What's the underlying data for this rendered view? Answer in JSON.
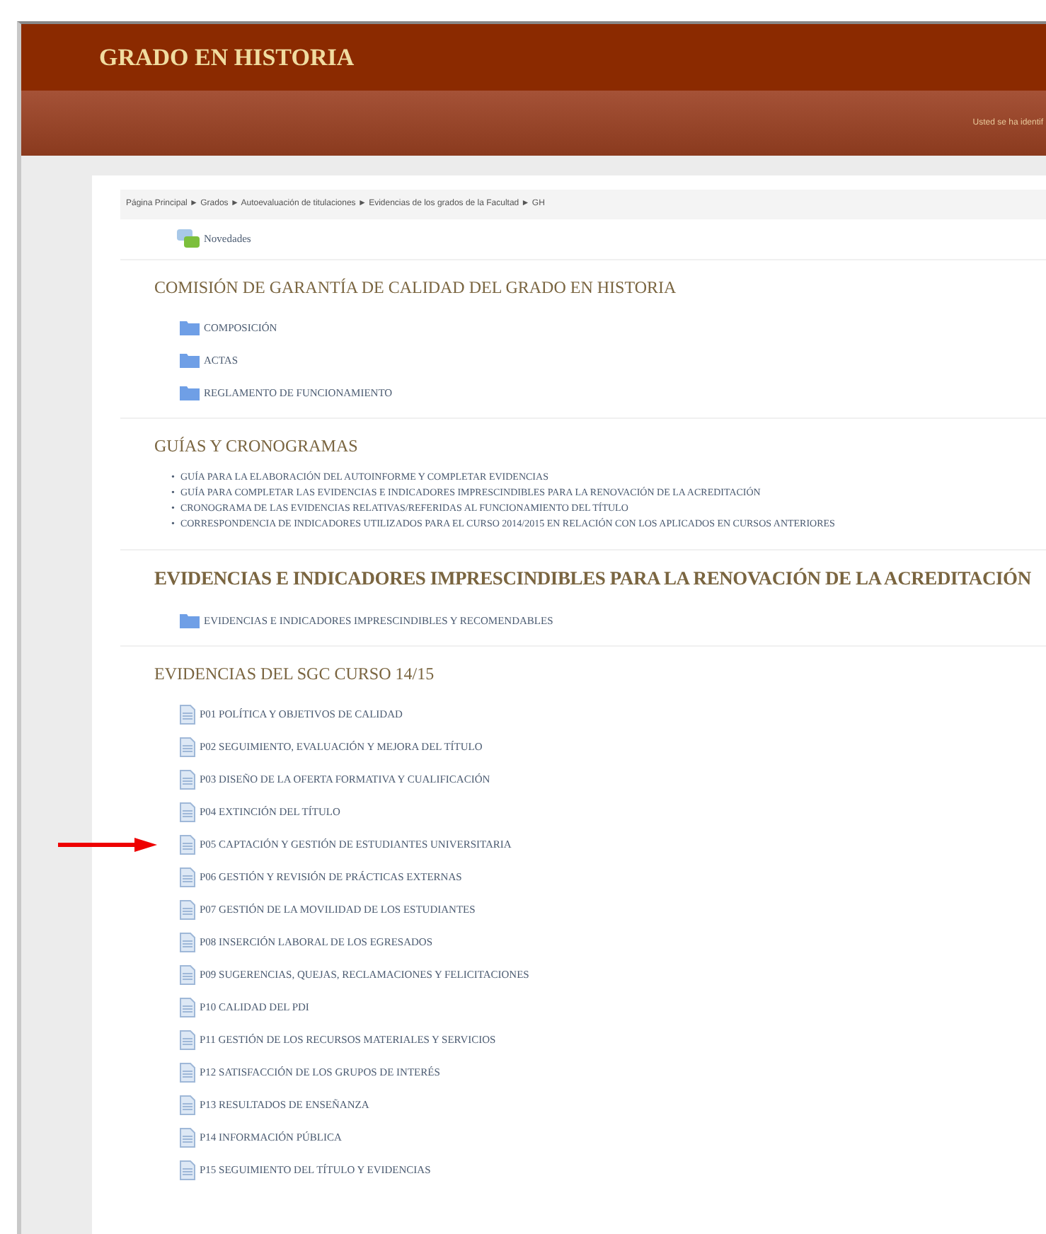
{
  "header": {
    "title": "GRADO EN HISTORIA",
    "user_text": "Usted se ha identif"
  },
  "breadcrumb": "Página Principal ► Grados ► Autoevaluación de titulaciones ► Evidencias de los grados de la Facultad ► GH",
  "top_items": [
    {
      "kind": "forum",
      "label": "Novedades"
    }
  ],
  "sections": [
    {
      "title": "COMISIÓN DE GARANTÍA DE CALIDAD DEL GRADO EN HISTORIA",
      "bold": false,
      "items": [
        {
          "kind": "folder",
          "label": "COMPOSICIÓN",
          "marked": false
        },
        {
          "kind": "folder",
          "label": "ACTAS",
          "marked": false
        },
        {
          "kind": "folder",
          "label": "REGLAMENTO DE FUNCIONAMIENTO",
          "marked": false
        }
      ]
    },
    {
      "title": "GUÍAS Y CRONOGRAMAS",
      "bold": false,
      "items": [
        {
          "kind": "bullet",
          "marker": "•",
          "label": "GUÍA PARA LA ELABORACIÓN DEL AUTOINFORME Y COMPLETAR EVIDENCIAS",
          "marked": false
        },
        {
          "kind": "bullet",
          "marker": "•",
          "label": "GUÍA PARA COMPLETAR LAS EVIDENCIAS E INDICADORES IMPRESCINDIBLES PARA LA RENOVACIÓN DE LA ACREDITACIÓN",
          "marked": false
        },
        {
          "kind": "bullet",
          "marker": "•",
          "label": "CRONOGRAMA DE LAS EVIDENCIAS RELATIVAS/REFERIDAS AL FUNCIONAMIENTO DEL TÍTULO",
          "marked": false
        },
        {
          "kind": "bullet",
          "marker": "•",
          "label": "CORRESPONDENCIA DE INDICADORES UTILIZADOS PARA EL CURSO 2014/2015 EN RELACIÓN CON LOS APLICADOS EN CURSOS ANTERIORES",
          "marked": false
        }
      ]
    },
    {
      "title": "EVIDENCIAS E INDICADORES IMPRESCINDIBLES PARA LA RENOVACIÓN DE LA ACREDITACIÓN",
      "bold": true,
      "items": [
        {
          "kind": "folder",
          "label": "EVIDENCIAS E INDICADORES IMPRESCINDIBLES Y RECOMENDABLES",
          "marked": false
        }
      ]
    },
    {
      "title": "EVIDENCIAS DEL SGC CURSO 14/15",
      "bold": false,
      "items": [
        {
          "kind": "file",
          "label": "P01 POLÍTICA Y OBJETIVOS DE CALIDAD",
          "marked": false
        },
        {
          "kind": "file",
          "label": "P02 SEGUIMIENTO, EVALUACIÓN Y MEJORA DEL TÍTULO",
          "marked": false
        },
        {
          "kind": "file",
          "label": "P03 DISEÑO DE LA OFERTA FORMATIVA Y CUALIFICACIÓN",
          "marked": false
        },
        {
          "kind": "file",
          "label": "P04 EXTINCIÓN DEL TÍTULO",
          "marked": false
        },
        {
          "kind": "file",
          "label": "P05 CAPTACIÓN Y GESTIÓN DE ESTUDIANTES UNIVERSITARIA",
          "marked": true
        },
        {
          "kind": "file",
          "label": "P06 GESTIÓN Y REVISIÓN DE PRÁCTICAS EXTERNAS",
          "marked": false
        },
        {
          "kind": "file",
          "label": "P07 GESTIÓN DE LA MOVILIDAD DE LOS ESTUDIANTES",
          "marked": false
        },
        {
          "kind": "file",
          "label": "P08 INSERCIÓN LABORAL DE LOS EGRESADOS",
          "marked": false
        },
        {
          "kind": "file",
          "label": "P09 SUGERENCIAS, QUEJAS, RECLAMACIONES Y FELICITACIONES",
          "marked": false
        },
        {
          "kind": "file",
          "label": "P10 CALIDAD DEL PDI",
          "marked": false
        },
        {
          "kind": "file",
          "label": "P11 GESTIÓN DE LOS RECURSOS MATERIALES Y SERVICIOS",
          "marked": false
        },
        {
          "kind": "file",
          "label": "P12 SATISFACCIÓN DE LOS GRUPOS DE INTERÉS",
          "marked": false
        },
        {
          "kind": "file",
          "label": "P13 RESULTADOS DE ENSEÑANZA",
          "marked": false
        },
        {
          "kind": "file",
          "label": "P14 INFORMACIÓN PÚBLICA",
          "marked": false
        },
        {
          "kind": "file",
          "label": "P15 SEGUIMIENTO DEL TÍTULO Y EVIDENCIAS",
          "marked": false
        }
      ]
    }
  ]
}
